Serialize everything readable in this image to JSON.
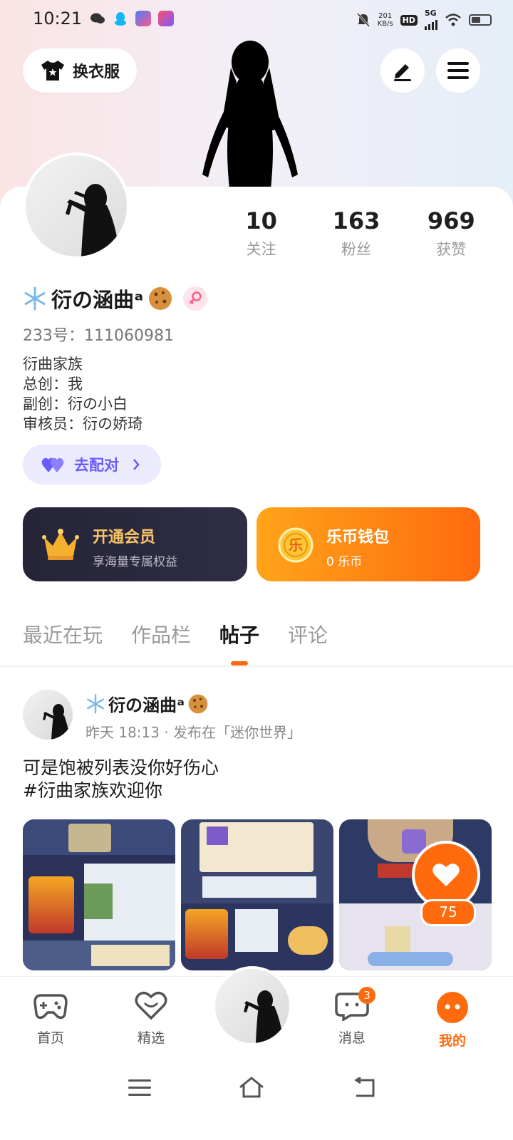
{
  "status_bar": {
    "time": "10:21",
    "net_speed_value": "201",
    "net_speed_unit": "KB/s",
    "hd": "HD",
    "network": "5G",
    "icons": [
      "wechat-icon",
      "qq-icon",
      "app-icon-1",
      "app-icon-2",
      "mute-icon",
      "signal-icon",
      "wifi-icon",
      "battery-icon"
    ]
  },
  "header": {
    "outfit_button": "换衣服"
  },
  "profile": {
    "stats": [
      {
        "value": "10",
        "label": "关注"
      },
      {
        "value": "163",
        "label": "粉丝"
      },
      {
        "value": "969",
        "label": "获赞"
      }
    ],
    "username": "衍の涵曲ᵃ",
    "uid": "233号：111060981",
    "bio_lines": [
      "衍曲家族",
      "总创：我",
      "副创：衍の小白",
      "审核员：衍の娇琦"
    ],
    "pair_button": "去配对"
  },
  "promos": {
    "vip": {
      "title": "开通会员",
      "subtitle": "享海量专属权益"
    },
    "wallet": {
      "title": "乐币钱包",
      "subtitle": "0 乐币"
    }
  },
  "tabs": [
    {
      "label": "最近在玩",
      "active": false
    },
    {
      "label": "作品栏",
      "active": false
    },
    {
      "label": "帖子",
      "active": true
    },
    {
      "label": "评论",
      "active": false
    }
  ],
  "post": {
    "author": "衍の涵曲ᵃ",
    "meta": "昨天  18:13 · 发布在「迷你世界」",
    "text_line1": "可是饱被列表没你好伤心",
    "text_line2": "#衍曲家族欢迎你",
    "likes": "75"
  },
  "bottom_nav": [
    {
      "label": "首页"
    },
    {
      "label": "精选"
    },
    {
      "label": "消息",
      "badge": "3"
    },
    {
      "label": "我的"
    }
  ],
  "colors": {
    "accent": "#ff6a0d",
    "vip_bg": "#262437",
    "pair_bg": "#ecebfd",
    "pair_text": "#6a5cff"
  }
}
